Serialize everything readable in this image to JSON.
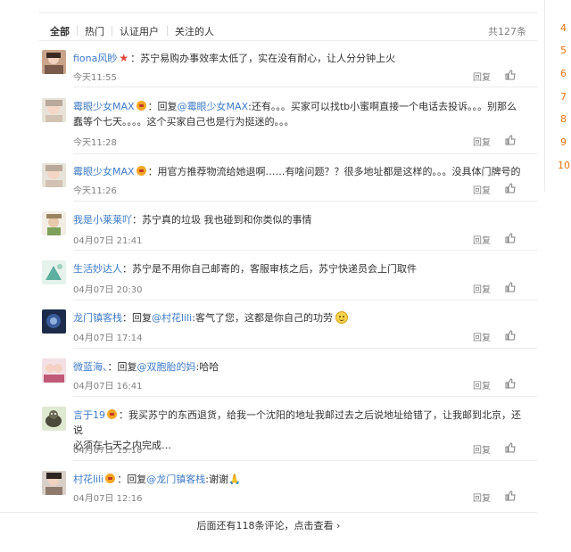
{
  "tabs": [
    {
      "label": "全部",
      "active": true
    },
    {
      "label": "热门",
      "active": false
    },
    {
      "label": "认证用户",
      "active": false
    },
    {
      "label": "关注的人",
      "active": false
    }
  ],
  "total": "共127条",
  "reply_label": "回复",
  "more": "后面还有118条评论，点击查看",
  "side_numbers": [
    "4",
    "5",
    "6",
    "7",
    "8",
    "9",
    "10"
  ],
  "comments": [
    {
      "user": "fiona风眇",
      "reply_to": "",
      "text": "：苏宁易购办事效率太低了，实在没有耐心，让人分分钟上火",
      "text2": "",
      "time": "今天11:55"
    },
    {
      "user": "霉眼少女MAX",
      "reply_prefix": "：回复",
      "reply_to": "@霉眼少女MAX",
      "text": ":还有。。。买家可以找tb小蜜啊直接一个电话去投诉。。。别那么",
      "text2": "蠢等个七天。。。。这个买家自己也是行为挺迷的。。。",
      "time": "今天11:28"
    },
    {
      "user": "霉眼少女MAX",
      "reply_to": "",
      "text": "：用官方推荐物流给她退啊……有啥问题？？很多地址都是这样的。。。没具体门牌号的",
      "text2": "",
      "time": "今天11:26"
    },
    {
      "user": "我是小莱莱吖",
      "reply_to": "",
      "text": "：苏宁真的垃圾 我也碰到和你类似的事情",
      "text2": "",
      "time": "04月07日 21:41"
    },
    {
      "user": "生活妙达人",
      "reply_to": "",
      "text": "：苏宁是不用你自己邮寄的，客服审核之后，苏宁快递员会上门取件",
      "text2": "",
      "time": "04月07日 20:30"
    },
    {
      "user": "龙门镇客栈",
      "reply_prefix": "：回复",
      "reply_to": "@村花lili",
      "text": ":客气了您，这都是你自己的功劳",
      "text2": "",
      "time": "04月07日 17:14"
    },
    {
      "user": "微蓝海、",
      "reply_prefix": "：回复",
      "reply_to": "@双胞胎的妈",
      "text": ":哈哈",
      "text2": "",
      "time": "04月07日 16:41"
    },
    {
      "user": "言于19",
      "reply_to": "",
      "text": "：我买苏宁的东西退货，给我一个沈阳的地址我邮过去之后说地址给错了，让我邮到北京，还说",
      "text2": "必须在七天之内完成…",
      "time": "04月07日 15:10"
    },
    {
      "user": "村花lili",
      "reply_prefix": "：回复",
      "reply_to": "@龙门镇客栈",
      "text": ":谢谢",
      "text2": "",
      "time": "04月07日 12:16"
    }
  ]
}
